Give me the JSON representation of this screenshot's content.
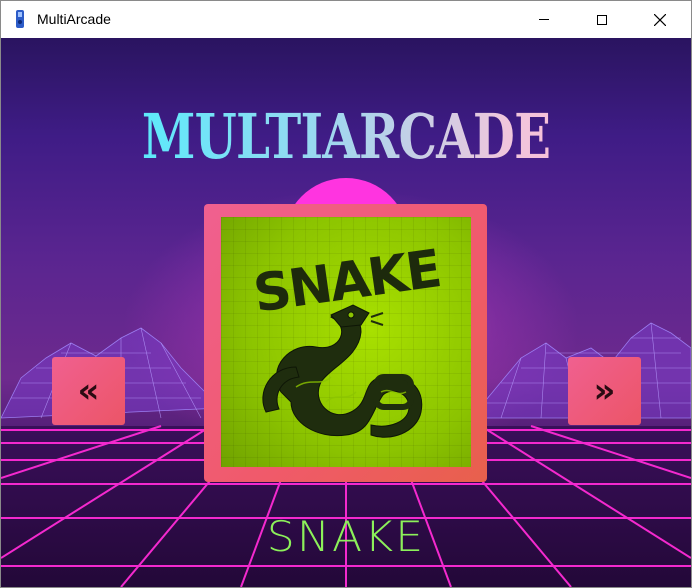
{
  "window": {
    "title": "MultiArcade",
    "icon": "app-icon",
    "controls": {
      "minimize": "minimize-icon",
      "maximize": "maximize-icon",
      "close": "close-icon"
    }
  },
  "app": {
    "logo_text": "MULTIARCADE",
    "game_art_title": "SNAKE",
    "prev_label": "«",
    "next_label": "»",
    "selected_game": "SNAKE"
  },
  "colors": {
    "accent_button": "#ee5a78",
    "game_screen": "#8cc400",
    "game_name": "#8cf05a",
    "sun": "#ff34e0"
  }
}
